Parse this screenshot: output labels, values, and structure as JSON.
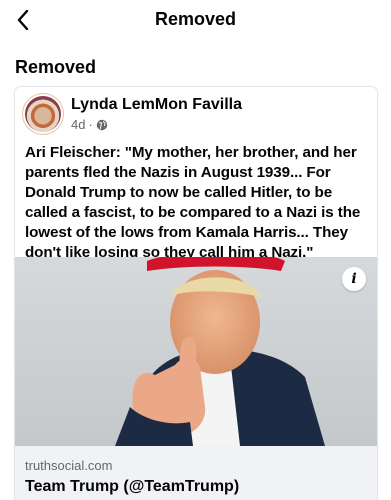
{
  "header": {
    "title": "Removed",
    "back_icon": "chevron-left-icon"
  },
  "section": {
    "title": "Removed"
  },
  "post": {
    "author": "Lynda LemMon Favilla",
    "time": "4d",
    "separator": "·",
    "audience_icon": "globe-icon",
    "text": "Ari Fleischer: \"My mother, her brother, and her parents fled the Nazis in August 1939... For Donald Trump to now be called Hitler, to be called a fascist, to be compared to a Nazi is the lowest of the lows from Kamala Harris... They don't like losing so they call him a Nazi.\"",
    "link": {
      "info_label": "i",
      "domain": "truthsocial.com",
      "title": "Team Trump (@TeamTrump)"
    }
  },
  "colors": {
    "text_primary": "#050505",
    "text_secondary": "#65676b",
    "link_footer_bg": "#f0f2f5",
    "hat_red": "#d1142c",
    "suit_navy": "#1c2a44"
  }
}
